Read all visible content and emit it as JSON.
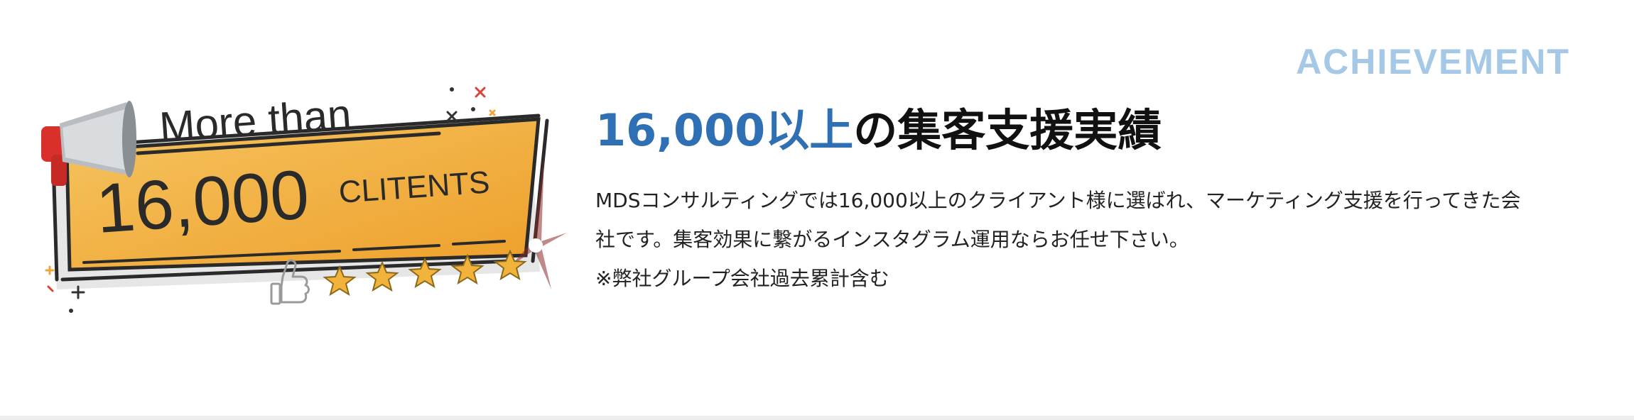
{
  "section": {
    "label": "ACHIEVEMENT"
  },
  "illustration": {
    "line_top": "More than",
    "big_number": "16,000",
    "unit": "CLITENTS",
    "icons": [
      "megaphone-icon",
      "thumbs-up-icon",
      "star-icon"
    ],
    "star_count": 5
  },
  "headline": {
    "accent": "16,000以上",
    "rest": "の集客支援実績"
  },
  "body": {
    "line1": "MDSコンサルティングでは16,000以上のクライアント様に選ばれ、マーケティング支援を行ってきた会",
    "line2": "社です。集客効果に繋がるインスタグラム運用ならお任せ下さい。",
    "note": "※弊社グループ会社過去累計含む"
  },
  "colors": {
    "accent": "#2f6fb3",
    "label": "#a4c8e6",
    "banner_orange": "#f2b33d",
    "text": "#111111"
  }
}
